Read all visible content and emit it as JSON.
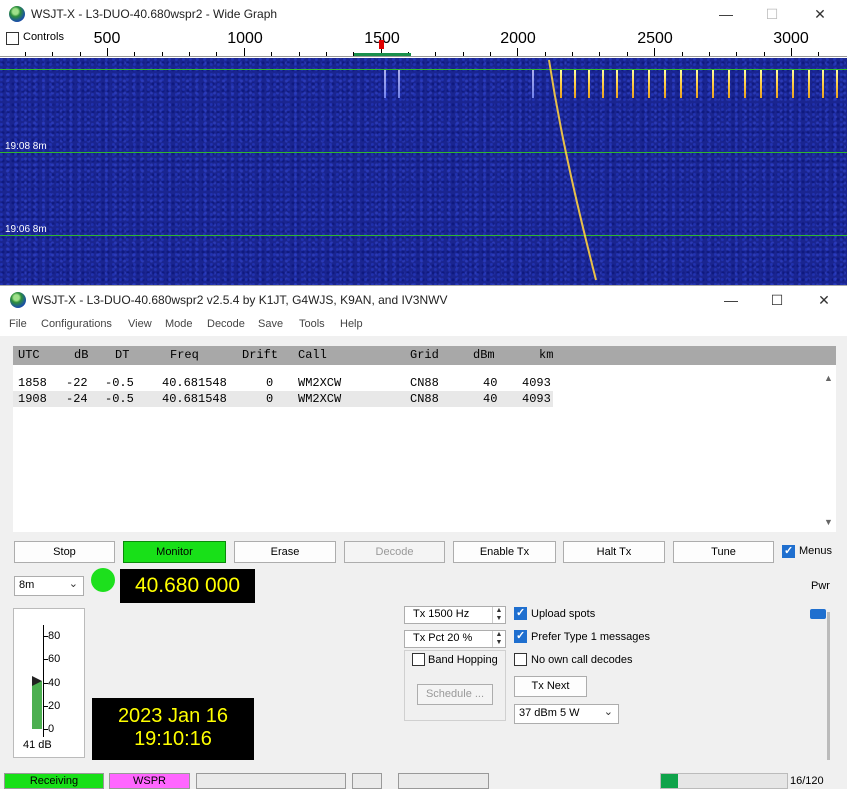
{
  "wide_graph": {
    "title": "WSJT-X - L3-DUO-40.680wspr2 - Wide Graph",
    "controls_label": "Controls",
    "scale_labels": [
      "500",
      "1000",
      "1500",
      "2000",
      "2500",
      "3000"
    ],
    "time_labels": [
      "19:08   8m",
      "19:06   8m"
    ],
    "window_buttons": {
      "minimize": "—",
      "maximize": "☐",
      "close": "✕"
    }
  },
  "main": {
    "title": "WSJT-X - L3-DUO-40.680wspr2   v2.5.4   by K1JT, G4WJS, K9AN, and IV3NWV",
    "window_buttons": {
      "minimize": "—",
      "maximize": "☐",
      "close": "✕"
    },
    "menu": [
      "File",
      "Configurations",
      "View",
      "Mode",
      "Decode",
      "Save",
      "Tools",
      "Help"
    ],
    "decode_columns": [
      "UTC",
      "dB",
      "DT",
      "Freq",
      "Drift",
      "Call",
      "Grid",
      "dBm",
      "km"
    ],
    "decode_rows": [
      [
        "1858",
        "-22",
        "-0.5",
        "40.681548",
        "0",
        "WM2XCW",
        "CN88",
        "40",
        "4093"
      ],
      [
        "1908",
        "-24",
        "-0.5",
        "40.681548",
        "0",
        "WM2XCW",
        "CN88",
        "40",
        "4093"
      ]
    ],
    "buttons": {
      "stop": "Stop",
      "monitor": "Monitor",
      "erase": "Erase",
      "decode": "Decode",
      "enable_tx": "Enable Tx",
      "halt_tx": "Halt Tx",
      "tune": "Tune"
    },
    "menus_label": "Menus",
    "band": "8m",
    "frequency": "40.680 000",
    "tx_freq": "Tx  1500  Hz",
    "tx_pct": "Tx Pct  20  %",
    "band_hopping": "Band Hopping",
    "schedule": "Schedule ...",
    "upload_spots": "Upload spots",
    "prefer_type1": "Prefer Type  1 messages",
    "no_own_call": "No own call decodes",
    "tx_next": "Tx Next",
    "power_select": "37 dBm  5 W",
    "pwr_label": "Pwr",
    "date": "2023 Jan 16",
    "time": "19:10:16",
    "meter": {
      "scale": [
        "80",
        "60",
        "40",
        "20",
        "0"
      ],
      "db_label": "41 dB",
      "level_db": 41
    },
    "status": {
      "receiving": "Receiving",
      "mode": "WSPR",
      "progress_label": "16/120",
      "progress_fraction": 0.133
    }
  },
  "colors": {
    "monitor_green": "#18e018",
    "mode_pink": "#ff66ff",
    "freq_yellow": "#ffff00",
    "accent_blue": "#1f6fcf"
  }
}
